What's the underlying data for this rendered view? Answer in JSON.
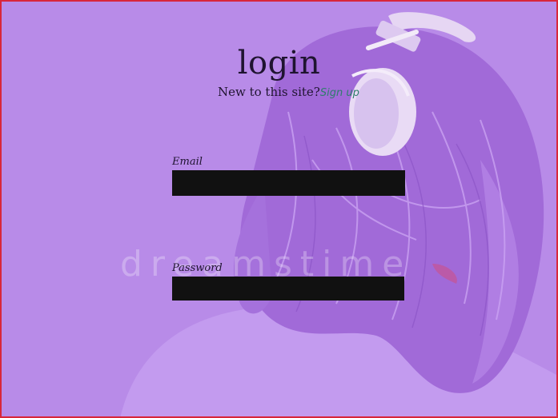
{
  "page": {
    "title": "login",
    "subtitle": "New to this site?",
    "signup_link": "Sign up",
    "accent_color": "#2e7d6b",
    "background_color": "#b88be8"
  },
  "form": {
    "email_label": "Email",
    "email_value": "",
    "password_label": "Password",
    "password_value": ""
  },
  "watermark": "dreamstime"
}
